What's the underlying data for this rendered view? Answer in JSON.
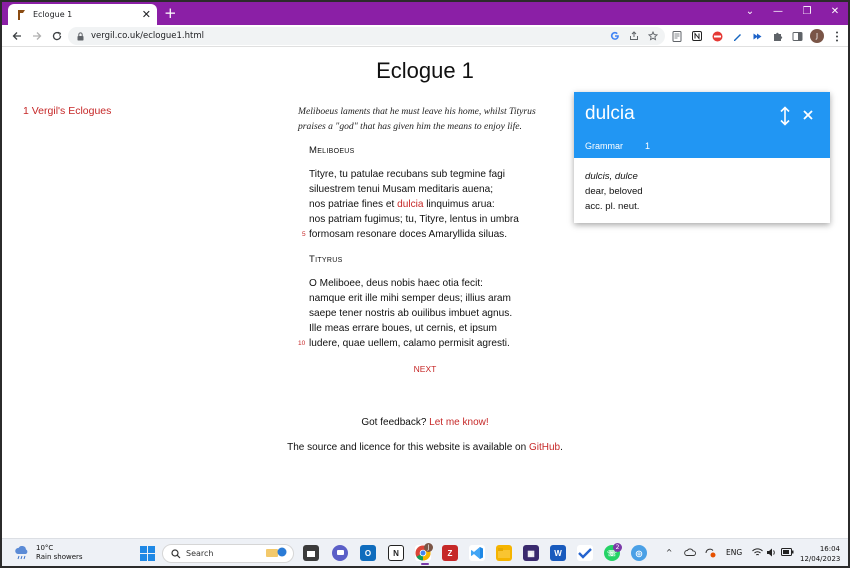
{
  "browser": {
    "tab_title": "Eclogue 1",
    "url": "vergil.co.uk/eclogue1.html",
    "accent_color": "#8b1fa6",
    "profile_initial": "J"
  },
  "page": {
    "title": "Eclogue 1",
    "sidenav_link": "1 Vergil's Eclogues",
    "intro_line1": "Meliboeus laments that he must leave his home, whilst Tityrus",
    "intro_line2": "praises a \"god\" that has given him the means to enjoy life.",
    "speaker1": "Meliboeus",
    "lines_a": {
      "l1": "Tityre, tu patulae recubans sub tegmine fagi",
      "l2": "siluestrem tenui Musam meditaris auena;",
      "l3_pre": "nos patriae fines et ",
      "l3_link": "dulcia",
      "l3_post": " linquimus arua:",
      "l4": "nos patriam fugimus; tu, Tityre, lentus in umbra",
      "l5": "formosam resonare doces Amaryllida siluas.",
      "n5": "5"
    },
    "speaker2": "Tityrus",
    "lines_b": {
      "l6": "O Meliboee, deus nobis haec otia fecit:",
      "l7": "namque erit ille mihi semper deus; illius aram",
      "l8": "saepe tener nostris ab ouilibus imbuet agnus.",
      "l9": "Ille meas errare boues, ut cernis, et ipsum",
      "l10": "ludere, quae uellem, calamo permisit agresti.",
      "n10": "10"
    },
    "next_label": "NEXT",
    "feedback_text": "Got feedback? ",
    "feedback_link": "Let me know!",
    "source_text": "The source and licence for this website is available on ",
    "source_link": "GitHub",
    "source_end": "."
  },
  "popup": {
    "word": "dulcia",
    "tab_label": "Grammar",
    "tab_count": "1",
    "forms": "dulcis, dulce",
    "meaning": "dear, beloved",
    "parse": "acc. pl. neut.",
    "header_color": "#2196f3"
  },
  "taskbar": {
    "temperature": "10°C",
    "weather": "Rain showers",
    "search_placeholder": "Search",
    "language": "ENG",
    "time": "16:04",
    "date": "12/04/2023",
    "chrome_badge": "J",
    "whatsapp_badge": "2"
  }
}
